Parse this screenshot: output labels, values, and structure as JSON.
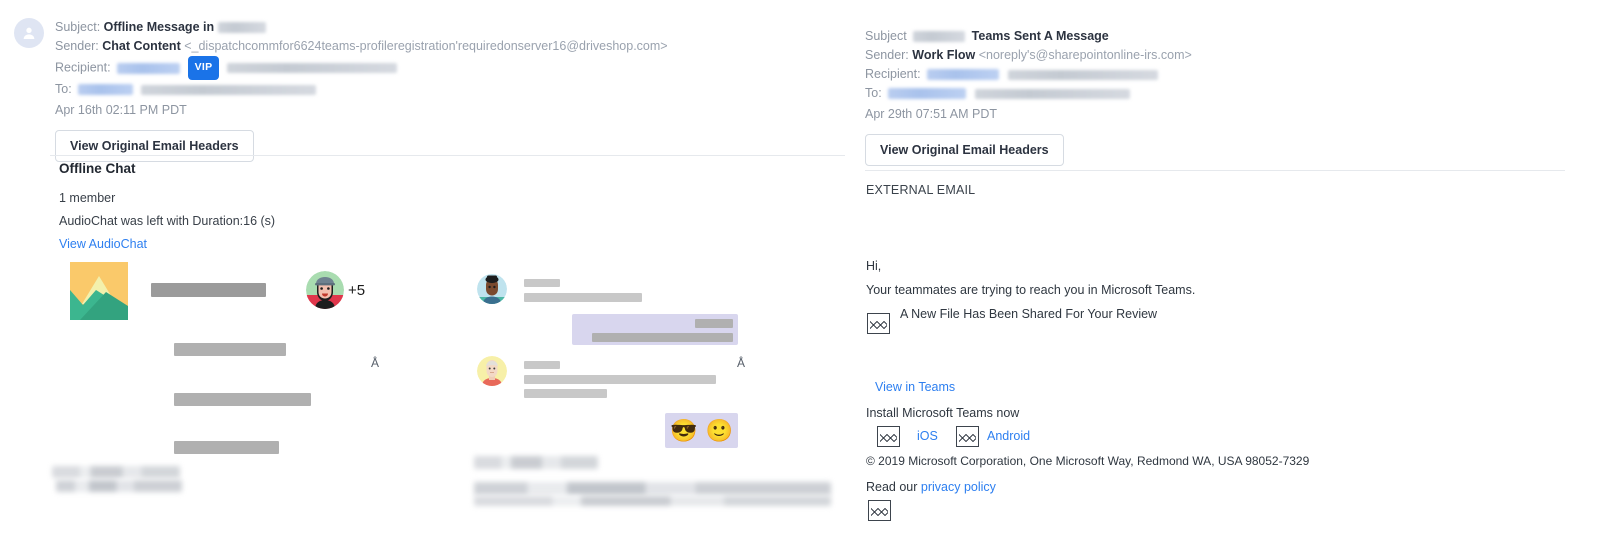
{
  "left_email": {
    "avatar_icon": "person-avatar-icon",
    "subject_label": "Subject:",
    "subject_value": "Offline Message in",
    "subject_redacted": true,
    "sender_label": "Sender:",
    "sender_name": "Chat Content",
    "sender_address": "<_dispatchcommfor6624teams-profileregistration'requiredonserver16@driveshop.com>",
    "recipient_label": "Recipient:",
    "recipient_badge": "VIP",
    "to_label": "To:",
    "date": "Apr 16th 02:11 PM PDT",
    "headers_button": "View Original Email Headers",
    "chat": {
      "title": "Offline Chat",
      "members": "1 member",
      "audio_note": "AudioChat was left with Duration:16 (s)",
      "view_link": "View AudioChat",
      "image_placeholder_icon": "landscape-image-icon",
      "group_avatar_icon": "bearded-person-avatar-icon",
      "group_overflow_count": "+5",
      "avatar_2_icon": "woman-avatar-icon",
      "avatar_3_icon": "older-person-avatar-icon",
      "artifact_char_1": "Å",
      "artifact_char_2": "Å",
      "reaction_emoji_1": "😎",
      "reaction_emoji_2": "🙂"
    }
  },
  "right_email": {
    "subject_label": "Subject",
    "subject_value": "Teams Sent A Message",
    "sender_label": "Sender:",
    "sender_name": "Work Flow",
    "sender_address": "<noreply's@sharepointonline-irs.com>",
    "recipient_label": "Recipient:",
    "to_label": "To:",
    "date": "Apr 29th 07:51 AM PDT",
    "headers_button": "View Original Email Headers",
    "body": {
      "external_banner": "EXTERNAL EMAIL",
      "greeting": "Hi,",
      "line_1": "Your teammates are trying to reach you in Microsoft Teams.",
      "file_icon": "broken-image-icon",
      "file_notice": "A New File Has Been Shared For Your Review",
      "view_link": "View in Teams",
      "install_text": "Install Microsoft Teams now",
      "ios_icon": "broken-image-icon",
      "ios_link": "iOS",
      "android_icon": "broken-image-icon",
      "android_link": "Android",
      "copyright": "© 2019 Microsoft Corporation, One Microsoft Way, Redmond WA, USA 98052-7329",
      "privacy_prefix": "Read our ",
      "privacy_link": "privacy policy",
      "footer_icon": "broken-image-icon"
    }
  },
  "colors": {
    "link": "#2d7ff0",
    "vip_badge": "#1a73e8",
    "bubble": "#d8d6ee",
    "text": "#2f3740",
    "muted": "#8d95a1"
  }
}
